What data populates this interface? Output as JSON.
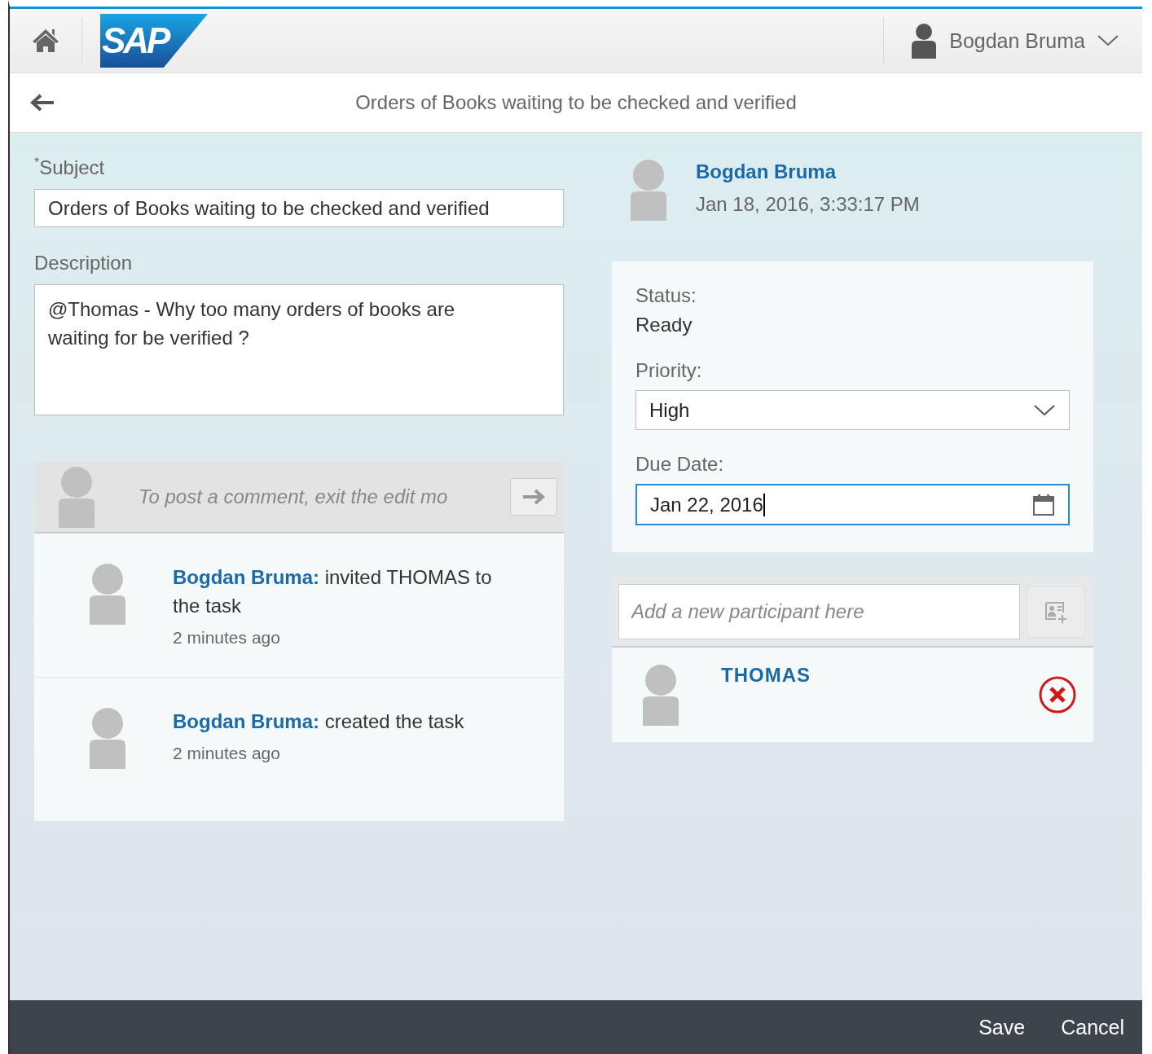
{
  "shell": {
    "logo": "SAP",
    "user": "Bogdan Bruma"
  },
  "page": {
    "title": "Orders of Books waiting to be checked and verified"
  },
  "form": {
    "subject": {
      "label": "$^{*}$Subject",
      "value": "Orders of Books waiting to be checked and verified"
    },
    "description": {
      "label": "Description",
      "value": "@Thomas - Why too many orders of books are waiting for be verified ?"
    }
  },
  "comments": {
    "placeholder": "To post a comment, exit the edit mo",
    "feed": [
      {
        "author": "Bogdan Bruma:",
        "text": "invited THOMAS to the task",
        "time": "2 minutes ago"
      },
      {
        "author": "Bogdan Bruma:",
        "text": "created the task",
        "time": "2 minutes ago"
      }
    ]
  },
  "task": {
    "creator": "Bogdan Bruma",
    "created": "Jan 18, 2016, 3:33:17 PM",
    "status_label": "Status:",
    "status": "Ready",
    "priority_label": "Priority:",
    "priority": "High",
    "due_label": "Due Date:",
    "due": "Jan 22, 2016"
  },
  "participants": {
    "placeholder": "Add a new participant here",
    "list": [
      {
        "name": "THOMAS"
      }
    ]
  },
  "footer": {
    "buttons": [
      "Save",
      "Cancel"
    ]
  }
}
